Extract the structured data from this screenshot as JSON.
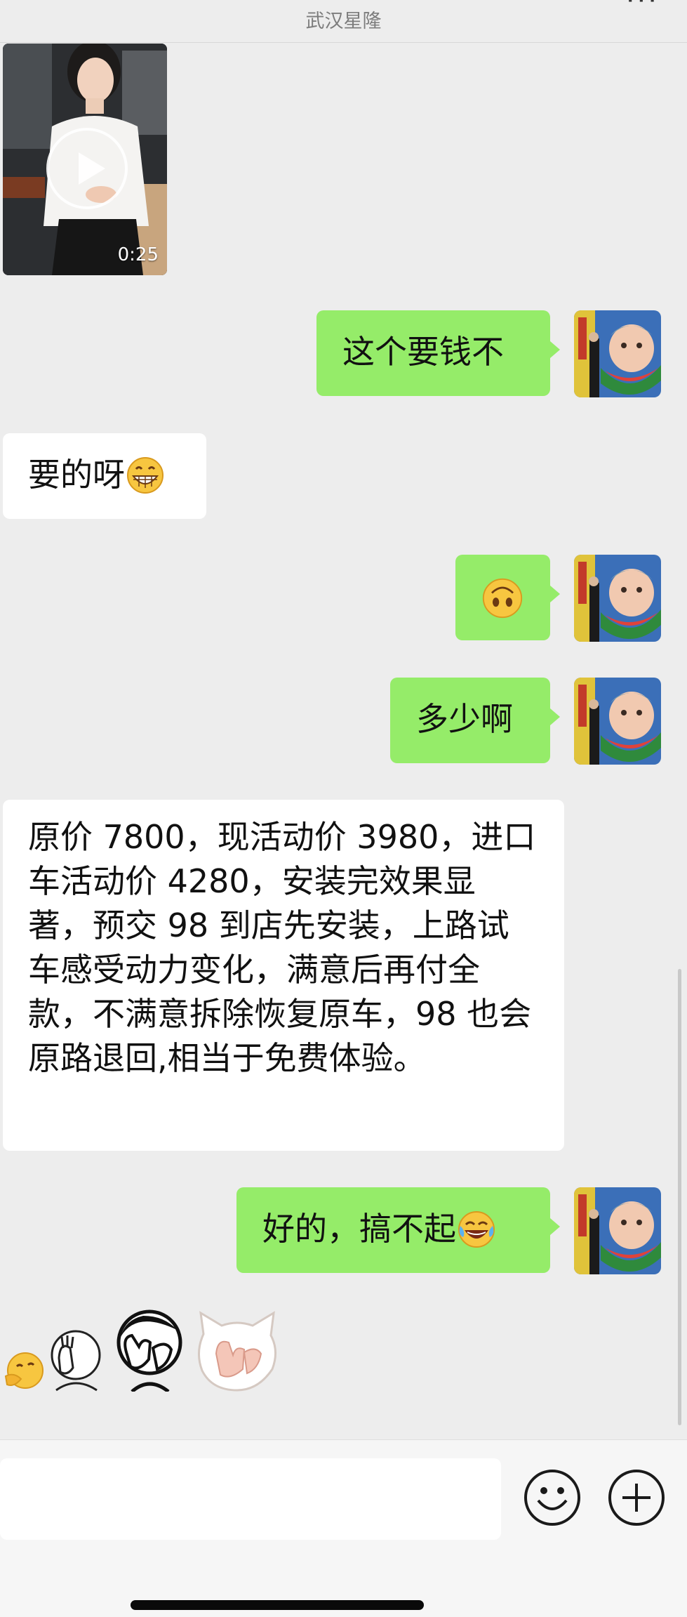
{
  "header": {
    "subtitle": "武汉星隆",
    "more_label": "···"
  },
  "video_message": {
    "duration": "0:25"
  },
  "messages": [
    {
      "side": "out",
      "text": "这个要钱不"
    },
    {
      "side": "in",
      "text": "要的呀"
    },
    {
      "side": "out",
      "text": ""
    },
    {
      "side": "out",
      "text": "多少啊"
    },
    {
      "side": "in",
      "text": "原价 7800，现活动价 3980，进口车活动价 4280，安装完效果显著，预交 98 到店先安装，上路试车感受动力变化，满意后再付全款，不满意拆除恢复原车，98 也会原路退回,相当于免费体验。"
    },
    {
      "side": "out",
      "text": "好的，搞不起"
    }
  ],
  "emojis": {
    "grin": "grinning-face",
    "upside": "upside-down-face",
    "laugh": "tears-of-joy-face"
  },
  "colors": {
    "outgoing_bubble": "#95ec69",
    "incoming_bubble": "#ffffff",
    "background": "#ededed"
  },
  "input_bar": {
    "emoji_button_icon": "smiley-icon",
    "plus_button_icon": "plus-icon"
  }
}
